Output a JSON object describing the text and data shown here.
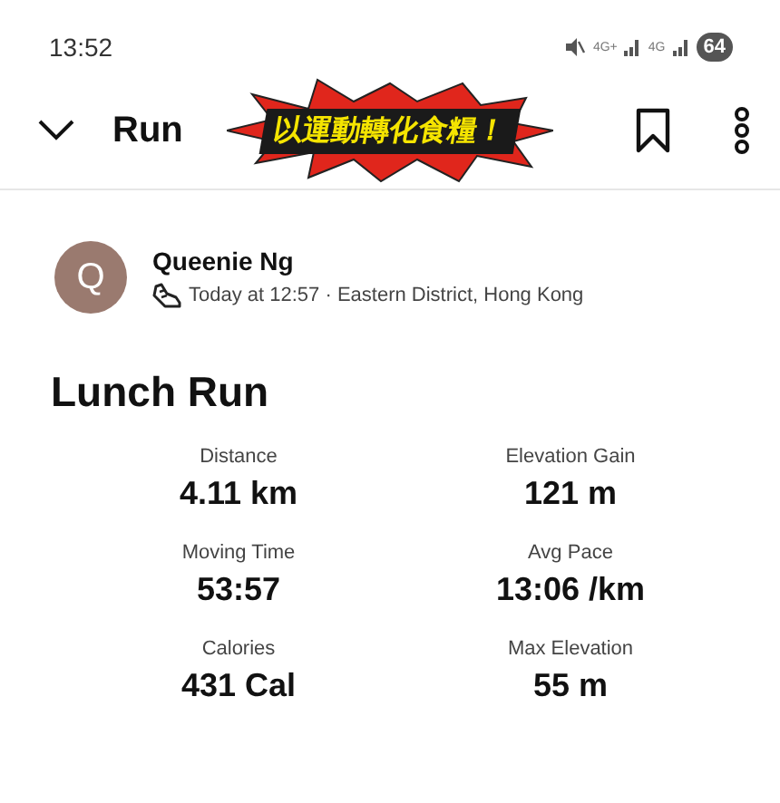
{
  "status_bar": {
    "time": "13:52",
    "network_labels": [
      "4G+",
      "4G"
    ],
    "battery": "64"
  },
  "header": {
    "title": "Run",
    "sticker": "以運動轉化食糧！"
  },
  "athlete": {
    "initial": "Q",
    "name": "Queenie Ng",
    "meta": "Today at 12:57 · Eastern District, Hong Kong"
  },
  "activity_title": "Lunch Run",
  "stats": [
    {
      "label": "Distance",
      "value": "4.11 km"
    },
    {
      "label": "Elevation Gain",
      "value": "121 m"
    },
    {
      "label": "Moving Time",
      "value": "53:57"
    },
    {
      "label": "Avg Pace",
      "value": "13:06 /km"
    },
    {
      "label": "Calories",
      "value": "431 Cal"
    },
    {
      "label": "Max Elevation",
      "value": "55 m"
    }
  ]
}
